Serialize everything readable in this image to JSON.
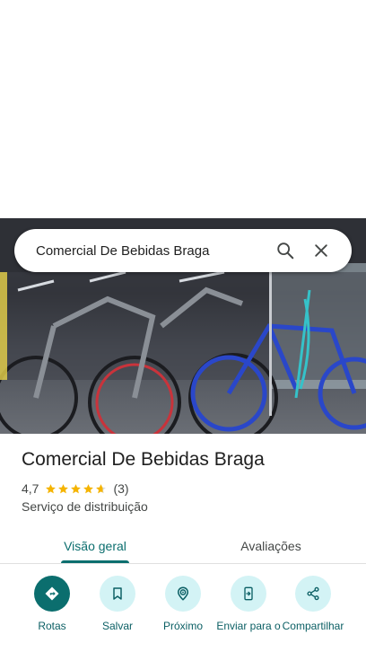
{
  "search": {
    "query": "Comercial De Bebidas Braga",
    "search_icon": "search-icon",
    "close_icon": "close-icon"
  },
  "place": {
    "title": "Comercial De Bebidas Braga",
    "rating": "4,7",
    "rating_value": 4.7,
    "stars_max": 5,
    "review_count": "(3)",
    "category": "Serviço de distribuição"
  },
  "tabs": [
    {
      "label": "Visão geral",
      "selected": true
    },
    {
      "label": "Avaliações",
      "selected": false
    }
  ],
  "actions": [
    {
      "label": "Rotas",
      "icon": "directions-icon"
    },
    {
      "label": "Salvar",
      "icon": "bookmark-icon"
    },
    {
      "label": "Próximo",
      "icon": "nearby-icon"
    },
    {
      "label": "Enviar para o",
      "icon": "send-to-phone-icon"
    },
    {
      "label": "Compartilhar",
      "icon": "share-icon"
    }
  ],
  "colors": {
    "accent": "#0b6e6e",
    "action_bg": "#d3f3f5",
    "star": "#f5b400"
  }
}
